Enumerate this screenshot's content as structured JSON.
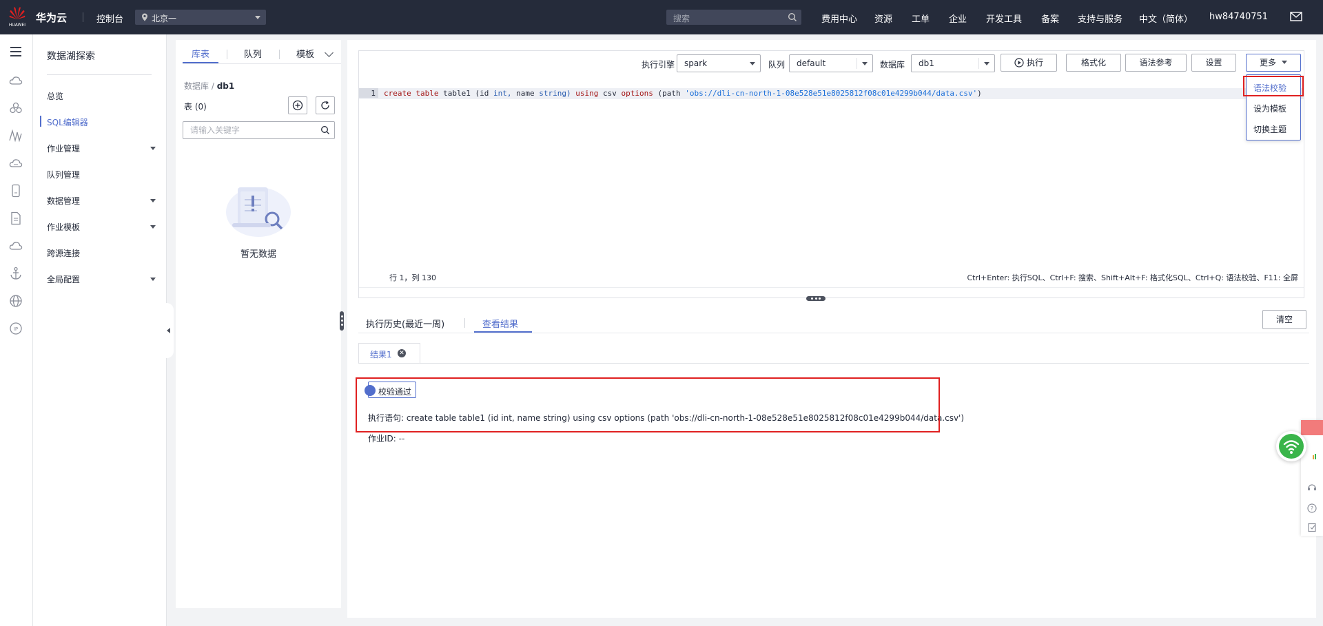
{
  "topbar": {
    "brand": "华为云",
    "logo_text": "HUAWEI",
    "console": "控制台",
    "region": "北京一",
    "search_placeholder": "搜索",
    "nav": [
      "费用中心",
      "资源",
      "工单",
      "企业",
      "开发工具",
      "备案",
      "支持与服务",
      "中文（简体）",
      "hw84740751"
    ],
    "icons": {
      "region": "location-pin-icon",
      "search": "search-icon",
      "mail": "mail-icon"
    }
  },
  "rail": {
    "icons": [
      "menu-icon",
      "cloud-icon",
      "cluster-icon",
      "graph-icon",
      "cloud-cdn-icon",
      "device-icon",
      "document-icon",
      "cloud-icon",
      "anchor-icon",
      "globe-icon",
      "ip-icon"
    ]
  },
  "leftnav": {
    "title": "数据湖探索",
    "items": [
      {
        "label": "总览",
        "active": false,
        "expandable": false
      },
      {
        "label": "SQL编辑器",
        "active": true,
        "expandable": false
      },
      {
        "label": "作业管理",
        "active": false,
        "expandable": true
      },
      {
        "label": "队列管理",
        "active": false,
        "expandable": false
      },
      {
        "label": "数据管理",
        "active": false,
        "expandable": true
      },
      {
        "label": "作业模板",
        "active": false,
        "expandable": true
      },
      {
        "label": "跨源连接",
        "active": false,
        "expandable": false
      },
      {
        "label": "全局配置",
        "active": false,
        "expandable": true
      }
    ]
  },
  "catalog": {
    "tabs": [
      "库表",
      "队列",
      "模板"
    ],
    "breadcrumb_prefix": "数据库",
    "breadcrumb_sep": "/",
    "breadcrumb_db": "db1",
    "table_count": "表 (0)",
    "search_placeholder": "请输入关键字",
    "empty_text": "暂无数据"
  },
  "toolbar": {
    "engine_label": "执行引擎",
    "engine_value": "spark",
    "queue_label": "队列",
    "queue_value": "default",
    "db_label": "数据库",
    "db_value": "db1",
    "run": "执行",
    "format": "格式化",
    "syntax_ref": "语法参考",
    "settings": "设置",
    "more": "更多"
  },
  "more_menu": [
    "语法校验",
    "设为模板",
    "切换主题"
  ],
  "editor": {
    "line_number": "1",
    "sql_kw_create": "create",
    "sql_kw_table": "table",
    "sql_name": "table1",
    "sql_open": "(id",
    "sql_type_int": "int,",
    "sql_col_name": "name",
    "sql_type_string": "string)",
    "sql_kw_using": "using",
    "sql_csv": "csv",
    "sql_kw_options": "options",
    "sql_path": "(path",
    "sql_literal": "'obs://dli-cn-north-1-08e528e51e8025812f08c01e4299b044/data.csv'",
    "sql_close": ")",
    "cursor_position": "行 1，列 130",
    "shortcuts": "Ctrl+Enter: 执行SQL、Ctrl+F: 搜索、Shift+Alt+F: 格式化SQL、Ctrl+Q: 语法校验、F11: 全屏"
  },
  "results": {
    "tab_history": "执行历史(最近一周)",
    "tab_results": "查看结果",
    "clear": "清空",
    "subtab": "结果1",
    "status": "校验通过",
    "statement": "执行语句: create table table1 (id int, name string) using csv options (path 'obs://dli-cn-north-1-08e528e51e8025812f08c01e4299b044/data.csv')",
    "job_id": "作业ID: --"
  },
  "colors": {
    "topbar": "#252b3a",
    "accent": "#526ecc",
    "highlight_box": "#e02020",
    "wifi": "#3ab54a"
  }
}
